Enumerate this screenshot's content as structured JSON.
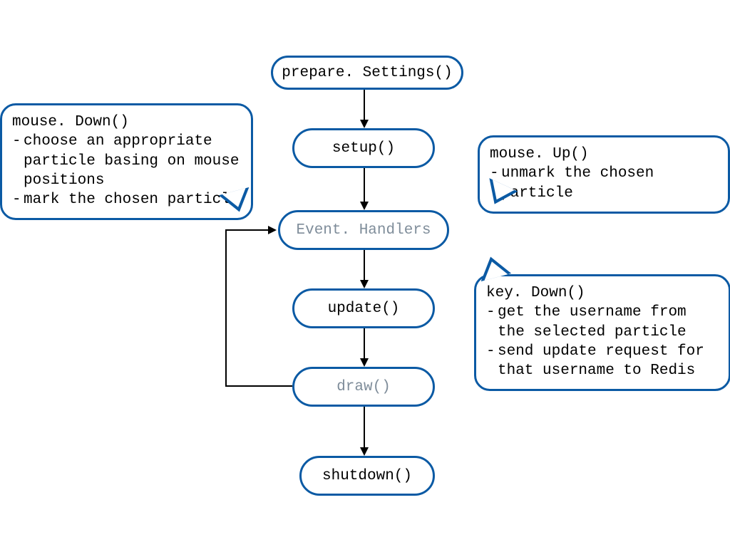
{
  "nodes": {
    "prepareSettings": "prepare. Settings()",
    "setup": "setup()",
    "eventHandlers": "Event. Handlers",
    "update": "update()",
    "draw": "draw()",
    "shutdown": "shutdown()"
  },
  "callouts": {
    "mouseDown": {
      "title": "mouse. Down()",
      "items": [
        "choose an appropriate particle basing on mouse positions",
        "mark the chosen particle"
      ]
    },
    "mouseUp": {
      "title": "mouse. Up()",
      "items": [
        "unmark the chosen particle"
      ]
    },
    "keyDown": {
      "title": "key. Down()",
      "items": [
        "get the username from the selected particle",
        "send update request for that username to Redis"
      ]
    }
  }
}
